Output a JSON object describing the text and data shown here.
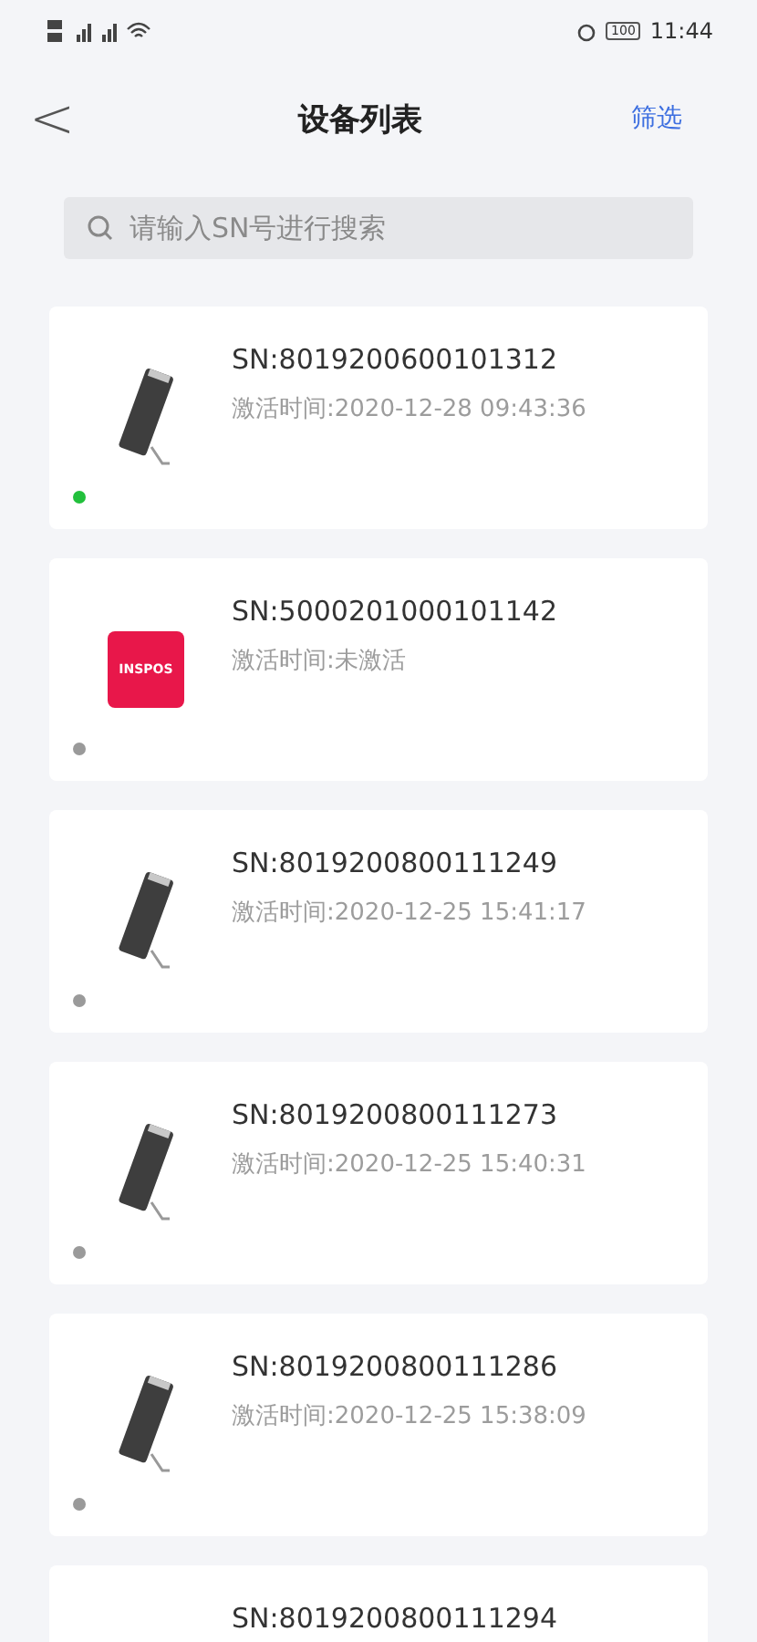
{
  "status_bar": {
    "battery": "100",
    "time": "11:44"
  },
  "header": {
    "back": "<",
    "title": "设备列表",
    "filter": "筛选"
  },
  "search": {
    "placeholder": "请输入SN号进行搜索"
  },
  "devices": [
    {
      "kind": "terminal",
      "sn": "SN:8019200600101312",
      "activation": "激活时间:2020-12-28 09:43:36",
      "color": "#22c03c"
    },
    {
      "kind": "logo",
      "logo_text": "INSPOS",
      "sn": "SN:5000201000101142",
      "activation": "激活时间:未激活",
      "color": "#9a9a9a"
    },
    {
      "kind": "terminal",
      "sn": "SN:8019200800111249",
      "activation": "激活时间:2020-12-25 15:41:17",
      "color": "#9a9a9a"
    },
    {
      "kind": "terminal",
      "sn": "SN:8019200800111273",
      "activation": "激活时间:2020-12-25 15:40:31",
      "color": "#9a9a9a"
    },
    {
      "kind": "terminal",
      "sn": "SN:8019200800111286",
      "activation": "激活时间:2020-12-25 15:38:09",
      "color": "#9a9a9a"
    },
    {
      "kind": "partial",
      "sn": "SN:8019200800111294"
    }
  ]
}
